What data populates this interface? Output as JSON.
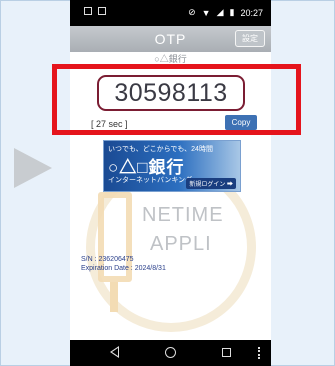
{
  "status_bar": {
    "time": "20:27"
  },
  "app_bar": {
    "title": "OTP",
    "settings_label": "設定"
  },
  "bank_name_small": "○△銀行",
  "otp": {
    "code": "30598113",
    "timer": "[ 27 sec ]",
    "copy_label": "Copy"
  },
  "banner": {
    "tagline": "いつでも、どこからでも、24時間",
    "bank_name": "○△□銀行",
    "service": "インターネットバンキング",
    "link": "新規ログイン ➡"
  },
  "watermark": {
    "line1": "NETIME",
    "line2": "APPLI"
  },
  "device": {
    "serial": "S/N : 236206475",
    "expiration": "Expiration Date : 2024/8/31"
  },
  "colors": {
    "highlight": "#e5141c",
    "otp_border": "#7b1d33",
    "copy_button": "#3d71b4"
  }
}
